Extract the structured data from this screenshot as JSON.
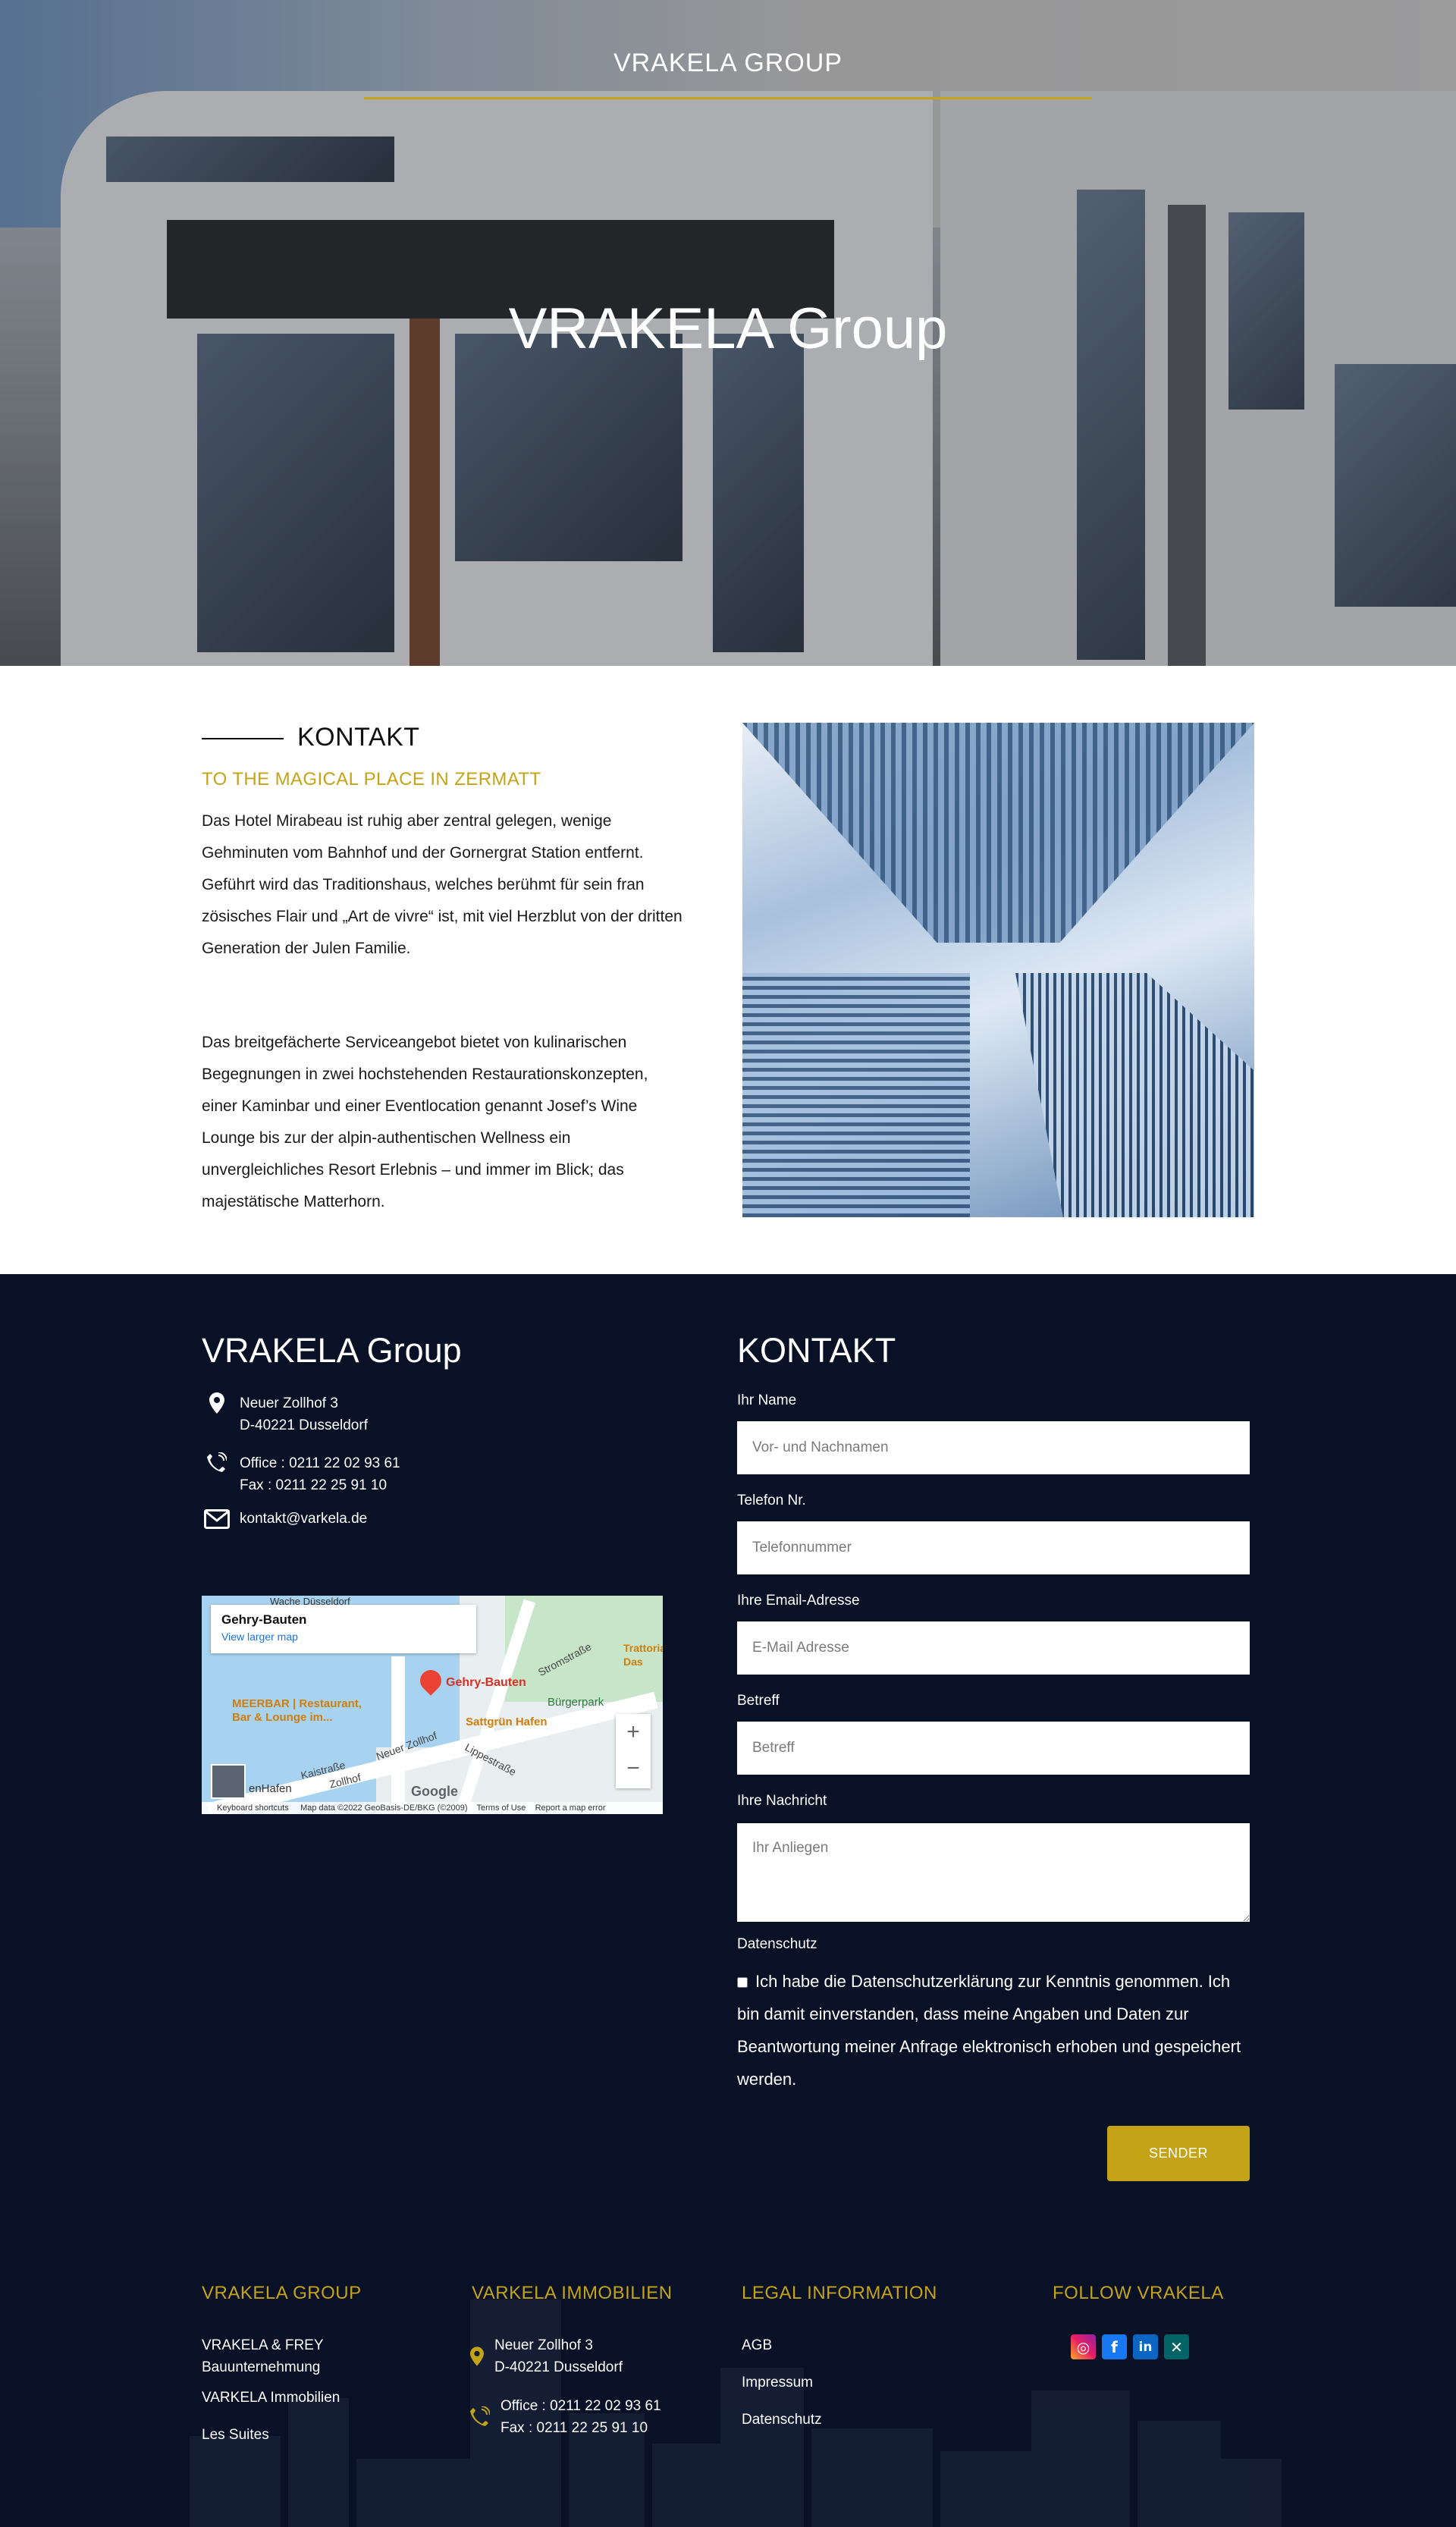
{
  "hero": {
    "top_title": "VRAKELA GROUP",
    "main_title": "VRAKELA Group"
  },
  "intro": {
    "heading": "KONTAKT",
    "subtitle": "TO THE MAGICAL PLACE IN ZERMATT",
    "paragraph1": "Das Hotel Mirabeau ist ruhig aber zentral gelegen, wenige Gehminuten vom Bahnhof und der Gornergrat Station entfernt. Geführt wird das Traditionshaus, welches berühmt für sein fran zösisches Flair und „Art de vivre“ ist, mit viel Herzblut von der dritten Generation der Julen Familie.",
    "paragraph2": "Das breitgefächerte Serviceangebot bietet von kulinarischen Begegnungen in zwei hochstehenden Restaurationskonzepten, einer Kaminbar und einer Eventlocation genannt Josef’s Wine Lounge bis zur der alpin-authentischen Wellness ein unvergleichliches Resort Erlebnis – und immer im Blick; das majestätische Matterhorn."
  },
  "contact": {
    "title": "VRAKELA Group",
    "address_line1": "Neuer Zollhof 3",
    "address_line2": "D-40221 Dusseldorf",
    "office": "Office : 0211 22 02 93 61",
    "fax": "Fax : 0211 22 25 91 10",
    "email": "kontakt@varkela.de",
    "icons": [
      "map-pin-icon",
      "phone-icon",
      "envelope-icon"
    ]
  },
  "map": {
    "place_name": "Gehry-Bauten",
    "larger_map": "View larger map",
    "pin_label": "Gehry-Bauten",
    "poi1": "MEERBAR | Restaurant, Bar & Lounge im...",
    "poi2": "Sattgrün Hafen",
    "poi3": "Bürgerpark",
    "poi4": "Trattoria Das",
    "street1": "Neuer Zollhof",
    "street2": "Kaistraße",
    "street3": "Stromstraße",
    "street4": "Lippestraße",
    "street5": "Zollhof",
    "area": "enHafen",
    "top_label": "Wache Düsseldorf",
    "zoom_in": "+",
    "zoom_out": "−",
    "brand": "Google",
    "attr1": "Keyboard shortcuts",
    "attr2": "Map data ©2022 GeoBasis-DE/BKG (©2009)",
    "attr3": "Terms of Use",
    "attr4": "Report a map error"
  },
  "form": {
    "title": "KONTAKT",
    "name_label": "Ihr Name",
    "name_placeholder": "Vor- und Nachnamen",
    "phone_label": "Telefon Nr.",
    "phone_placeholder": "Telefonnummer",
    "email_label": "Ihre Email-Adresse",
    "email_placeholder": "E-Mail Adresse",
    "subject_label": "Betreff",
    "subject_placeholder": "Betreff",
    "message_label": "Ihre Nachricht",
    "message_placeholder": "Ihr Anliegen",
    "privacy_label": "Datenschutz",
    "consent_text": "Ich habe die Datenschutzerklärung zur Kenntnis genommen. Ich bin damit einverstanden, dass meine Angaben und Daten zur Beantwortung meiner Anfrage elektronisch erhoben und gespeichert werden.",
    "submit": "SENDER"
  },
  "footer": {
    "col1_title": "VRAKELA GROUP",
    "col1_item1a": "VRAKELA & FREY",
    "col1_item1b": "Bauunternehmung",
    "col1_item2": "VARKELA Immobilien",
    "col1_item3": "Les Suites",
    "col2_title": "VARKELA IMMOBILIEN",
    "col2_addr1": "Neuer Zollhof 3",
    "col2_addr2": "D-40221 Dusseldorf",
    "col2_office": "Office : 0211 22 02 93 61",
    "col2_fax": "Fax : 0211 22 25 91 10",
    "col3_title": "LEGAL INFORMATION",
    "col3_item1": "AGB",
    "col3_item2": "Impressum",
    "col3_item3": "Datenschutz",
    "col4_title": "FOLLOW VRAKELA",
    "social": [
      "instagram-icon",
      "facebook-icon",
      "linkedin-icon",
      "xing-icon"
    ]
  },
  "colors": {
    "accent": "#c4a317",
    "dark_bg": "#081126"
  }
}
